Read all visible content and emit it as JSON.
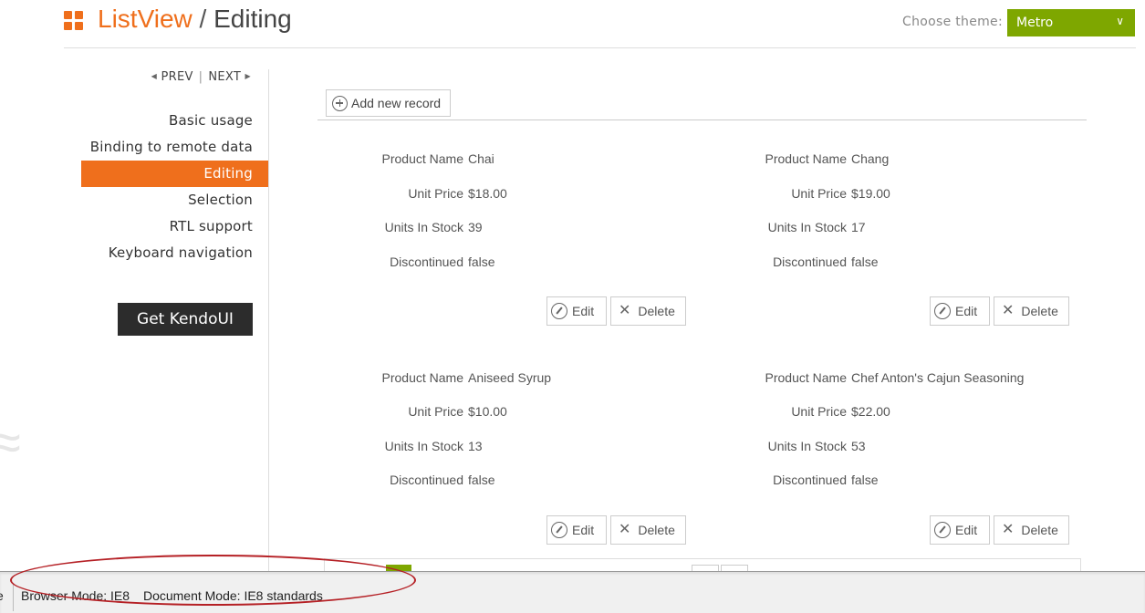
{
  "header": {
    "title_widget": "ListView",
    "title_sep": "/",
    "title_page": "Editing",
    "theme_label": "Choose theme:",
    "theme_value": "Metro",
    "theme_color": "#7ea700"
  },
  "sidebar": {
    "prev_label": "PREV",
    "next_label": "NEXT",
    "items": [
      {
        "label": "Basic usage"
      },
      {
        "label": "Binding to remote data"
      },
      {
        "label": "Editing"
      },
      {
        "label": "Selection"
      },
      {
        "label": "RTL support"
      },
      {
        "label": "Keyboard navigation"
      }
    ],
    "active_index": 2,
    "cta_label": "Get KendoUI",
    "accent": "#ef6f1c"
  },
  "listview": {
    "add_label": "Add new record",
    "edit_label": "Edit",
    "delete_label": "Delete",
    "field_labels": {
      "name": "Product Name",
      "price": "Unit Price",
      "stock": "Units In Stock",
      "disc": "Discontinued"
    },
    "products": [
      {
        "name": "Chai",
        "price": "$18.00",
        "stock": "39",
        "disc": "false"
      },
      {
        "name": "Chang",
        "price": "$19.00",
        "stock": "17",
        "disc": "false"
      },
      {
        "name": "Aniseed Syrup",
        "price": "$10.00",
        "stock": "13",
        "disc": "false"
      },
      {
        "name": "Chef Anton's Cajun Seasoning",
        "price": "$22.00",
        "stock": "53",
        "disc": "false"
      }
    ]
  },
  "statusbar": {
    "edge_char": "e",
    "browser_mode_label": "Browser Mode:",
    "browser_mode_value": "IE8",
    "document_mode_label": "Document Mode:",
    "document_mode_value": "IE8 standards",
    "annotation_color": "#b52025"
  }
}
